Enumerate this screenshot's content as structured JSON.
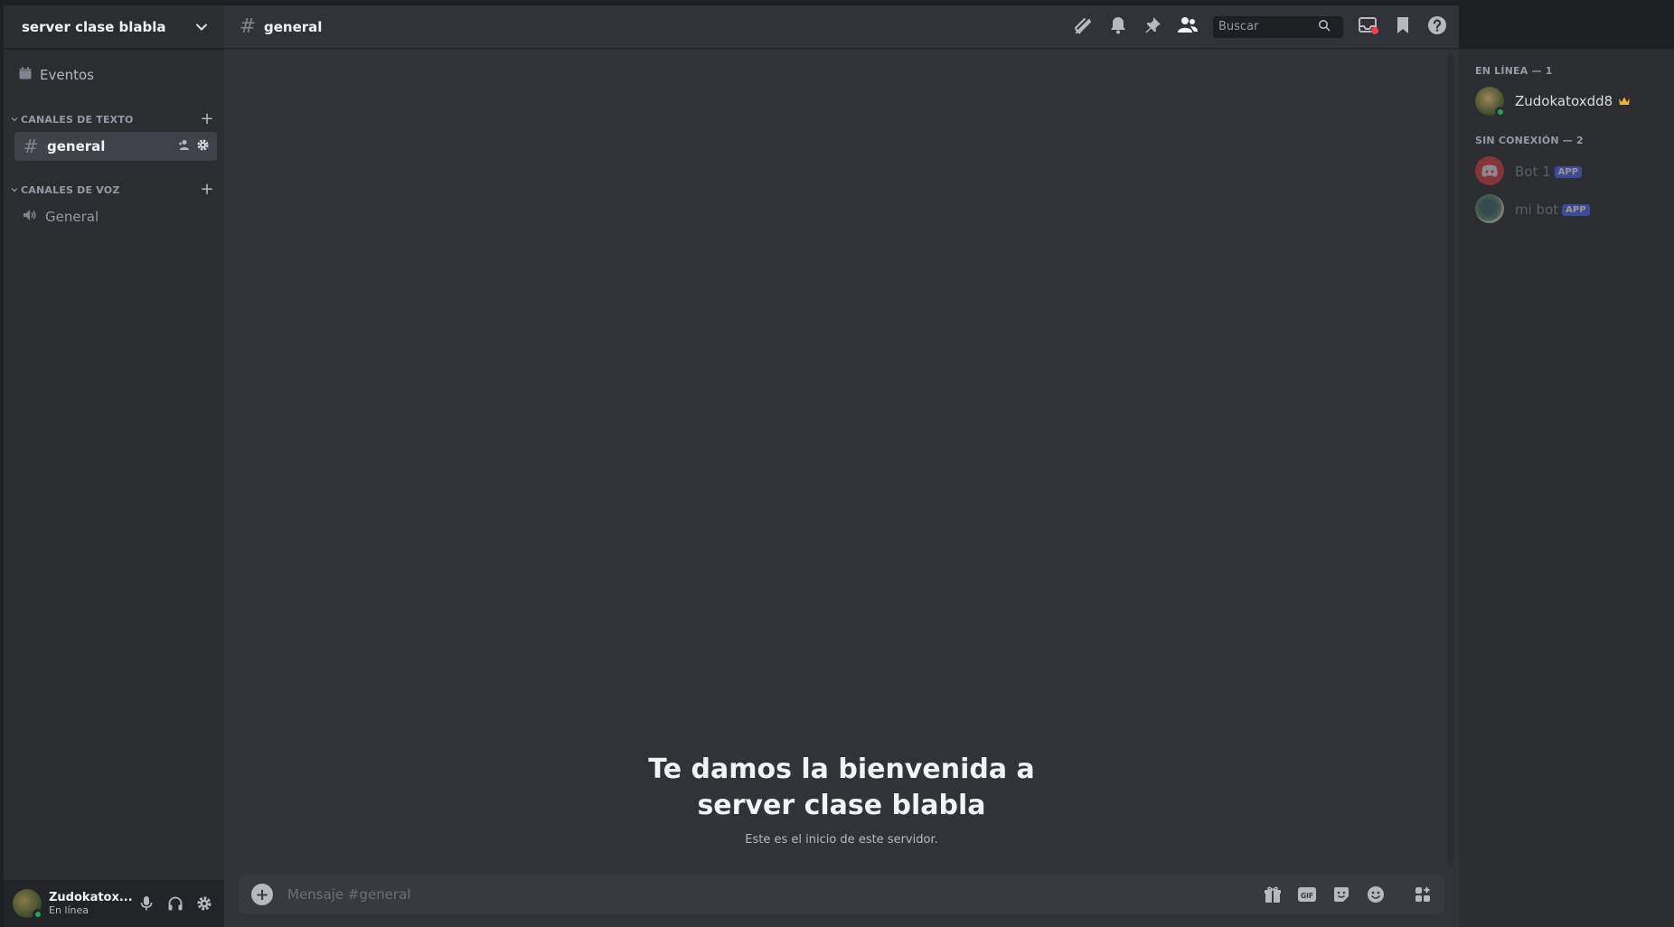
{
  "server": {
    "name": "server clase blabla"
  },
  "sidebar": {
    "events_label": "Eventos",
    "text_category": "CANALES DE TEXTO",
    "voice_category": "CANALES DE VOZ",
    "text_channels": [
      {
        "name": "general"
      }
    ],
    "voice_channels": [
      {
        "name": "General"
      }
    ]
  },
  "user": {
    "name": "Zudokatox...",
    "status": "En línea"
  },
  "header": {
    "channel": "general",
    "search_placeholder": "Buscar"
  },
  "welcome": {
    "line1": "Te damos la bienvenida a",
    "line2": "server clase blabla",
    "subtitle": "Este es el inicio de este servidor."
  },
  "composer": {
    "placeholder": "Mensaje #general"
  },
  "members": {
    "online_header": "EN LÍNEA — 1",
    "offline_header": "SIN CONEXIÓN — 2",
    "online": [
      {
        "name": "Zudokatoxdd8"
      }
    ],
    "offline": [
      {
        "name": "Bot 1",
        "badge": "APP"
      },
      {
        "name": "mi bot",
        "badge": "APP"
      }
    ]
  },
  "colors": {
    "online": "#23a55a",
    "badge": "#5865f2",
    "crown": "#f0b232",
    "notify": "#f23f43"
  }
}
